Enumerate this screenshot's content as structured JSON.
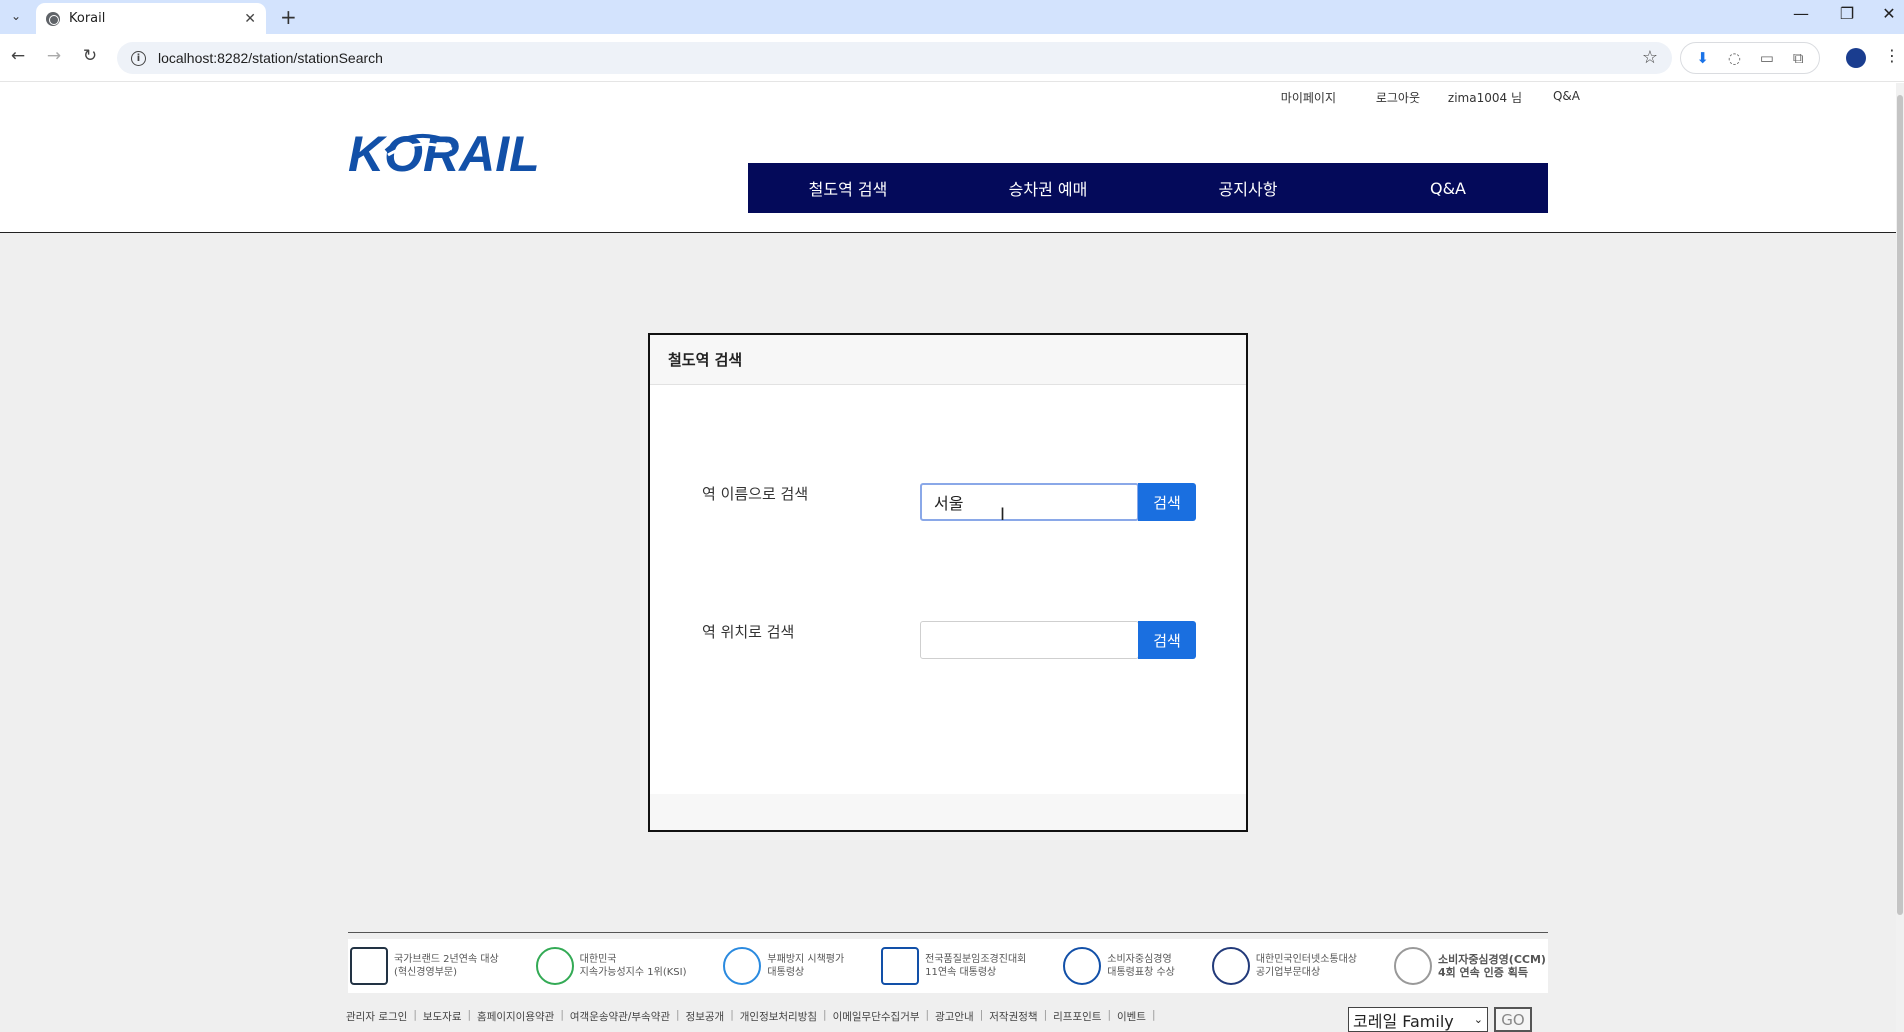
{
  "browser": {
    "tab_title": "Korail",
    "url": "localhost:8282/station/stationSearch",
    "tab_close": "✕",
    "new_tab": "+"
  },
  "utility_nav": [
    "마이페이지",
    "로그아웃",
    "zima1004 님",
    "Q&A"
  ],
  "logo_text": "KORAIL",
  "gnb": [
    "철도역 검색",
    "승차권 예매",
    "공지사항",
    "Q&A"
  ],
  "panel": {
    "title": "철도역 검색",
    "name_search": {
      "label": "역 이름으로 검색",
      "value": "서울",
      "button": "검색"
    },
    "location_search": {
      "label": "역 위치로 검색",
      "value": "",
      "button": "검색"
    }
  },
  "awards": [
    "국가브랜드 2년연속 대상\n(혁신경영부문)",
    "대한민국\n지속가능성지수 1위(KSI)",
    "부패방지 시책평가\n대통령상",
    "전국품질분임조경진대회\n11연속 대통령상",
    "소비자중심경영\n대통령표창 수상",
    "대한민국인터넷소통대상\n공기업부문대상",
    "소비자중심경영(CCM)\n4회 연속 인증 획득"
  ],
  "footer_links": [
    "관리자 로그인",
    "보도자료",
    "홈페이지이용약관",
    "여객운송약관/부속약관",
    "정보공개",
    "개인정보처리방침",
    "이메일무단수집거부",
    "광고안내",
    "저작권정책",
    "리프포인트",
    "이벤트"
  ],
  "family_select": "코레일 Family",
  "go_button": "GO",
  "colors": {
    "gnb_bg": "#040a5a",
    "button_blue": "#1a6fe0",
    "logo_blue": "#1250a8"
  }
}
